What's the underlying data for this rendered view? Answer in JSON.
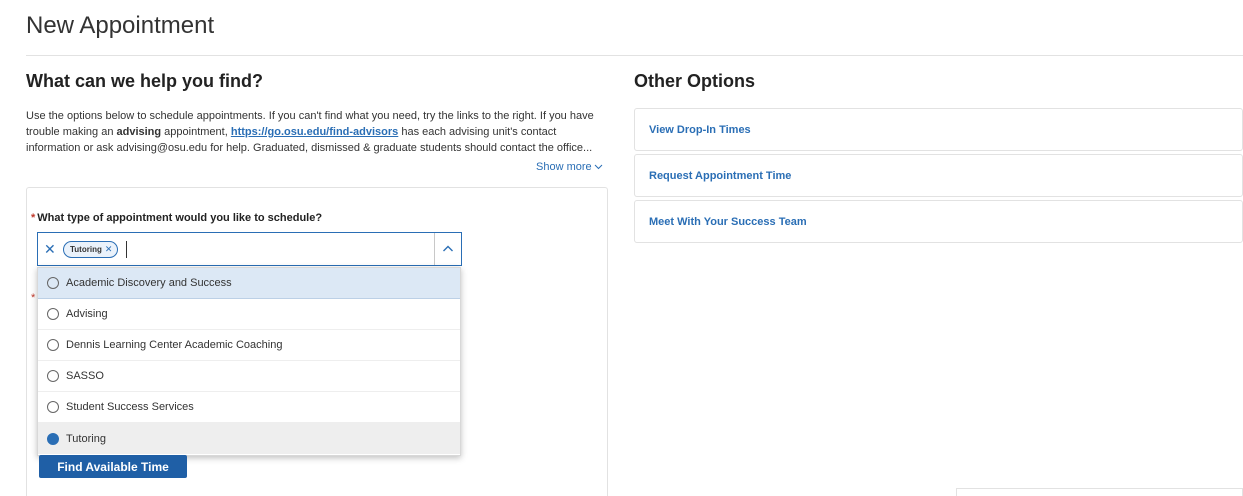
{
  "page": {
    "title": "New Appointment"
  },
  "help": {
    "heading": "What can we help you find?",
    "text_before_bold": "Use the options below to schedule appointments. If you can't find what you need, try the links to the right. If you have trouble making an ",
    "bold_word": "advising",
    "text_mid": " appointment, ",
    "link_text": "https://go.osu.edu/find-advisors",
    "text_after": " has each advising unit's contact information or ask advising@osu.edu for help. Graduated, dismissed & graduate students should contact the office...",
    "show_more": "Show more"
  },
  "form": {
    "question_label": "What type of appointment would you like to schedule?",
    "selected_chip": "Tutoring",
    "options": [
      {
        "label": "Academic Discovery and Success",
        "selected": false
      },
      {
        "label": "Advising",
        "selected": false
      },
      {
        "label": "Dennis Learning Center Academic Coaching",
        "selected": false
      },
      {
        "label": "SASSO",
        "selected": false
      },
      {
        "label": "Student Success Services",
        "selected": false
      },
      {
        "label": "Tutoring",
        "selected": true
      }
    ],
    "submit_label": "Find Available Time"
  },
  "other_options": {
    "heading": "Other Options",
    "links": [
      {
        "label": "View Drop-In Times"
      },
      {
        "label": "Request Appointment Time"
      },
      {
        "label": "Meet With Your Success Team"
      }
    ]
  },
  "colors": {
    "accent": "#2a6eb5",
    "button": "#1f5fa6",
    "required": "#c0392b"
  },
  "icons": {
    "clear": "close-icon",
    "toggle": "chevron-up-icon",
    "show_more": "chevron-down-icon"
  }
}
